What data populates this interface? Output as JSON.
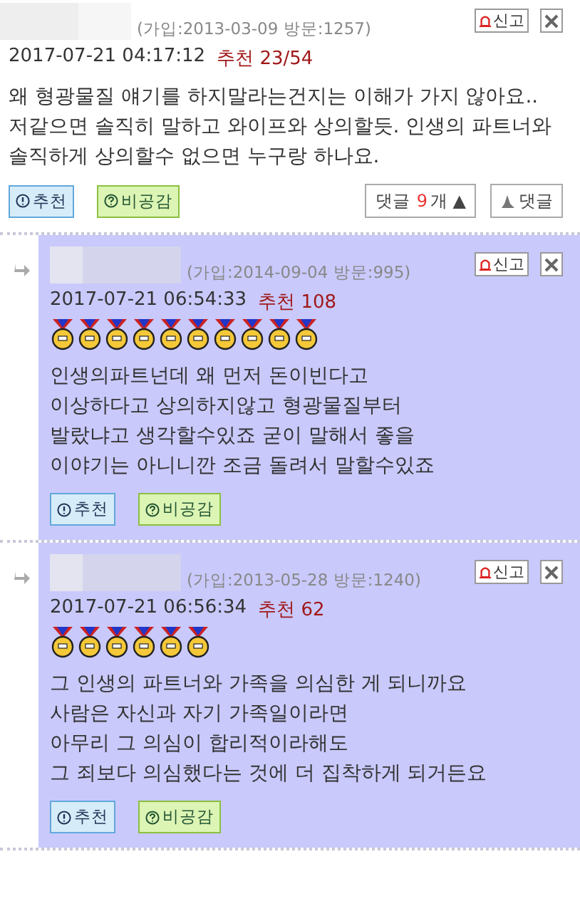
{
  "comments": [
    {
      "kind": "post",
      "meta": "(가입:2013-03-09 방문:1257)",
      "report": "신고",
      "datetime": "2017-07-21 04:17:12",
      "rec_label": "추천",
      "rec_value": "23/54",
      "paragraphs": [
        "왜 형광물질 얘기를 하지말라는건지는 이해가 가지 않아요..",
        "저같으면 솔직히 말하고 와이프와 상의할듯. 인생의 파트너와 솔직하게 상의할수 없으면 누구랑 하나요."
      ],
      "recommend": "추천",
      "disagree": "비공감",
      "comments_button": {
        "before": "댓글",
        "count": "9",
        "after": "개 ▲"
      },
      "reply_button": "댓글"
    },
    {
      "kind": "reply",
      "meta": "(가입:2014-09-04 방문:995)",
      "report": "신고",
      "datetime": "2017-07-21 06:54:33",
      "rec_label": "추천",
      "rec_value": "108",
      "stars": 10,
      "paragraphs": [
        "인생의파트넌데 왜 먼저 돈이빈다고",
        "이상하다고 상의하지않고 형광물질부터",
        "발랐냐고 생각할수있죠  굳이 말해서 좋을",
        "이야기는 아니니깐 조금 돌려서 말할수있죠"
      ],
      "recommend": "추천",
      "disagree": "비공감"
    },
    {
      "kind": "reply",
      "meta": "(가입:2013-05-28 방문:1240)",
      "report": "신고",
      "datetime": "2017-07-21 06:56:34",
      "rec_label": "추천",
      "rec_value": "62",
      "stars": 6,
      "paragraphs": [
        "그 인생의 파트너와 가족을 의심한 게 되니까요",
        "사람은 자신과 자기 가족일이라면",
        "아무리 그 의심이 합리적이라해도",
        "그 죄보다 의심했다는 것에 더 집착하게 되거든요"
      ],
      "recommend": "추천",
      "disagree": "비공감"
    }
  ]
}
